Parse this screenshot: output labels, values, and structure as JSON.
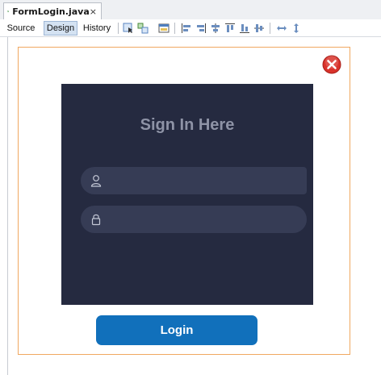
{
  "editor": {
    "file_tab": {
      "name": "FormLogin.java",
      "close": "×"
    },
    "views": [
      "Source",
      "Design",
      "History"
    ],
    "active_view": "Design"
  },
  "form": {
    "title": "Sign In Here",
    "username": {
      "value": "",
      "placeholder": ""
    },
    "password": {
      "value": "",
      "placeholder": ""
    },
    "login_label": "Login"
  },
  "colors": {
    "panel_bg": "#252a40",
    "field_bg": "#363c55",
    "title_color": "#8e93a6",
    "button_bg": "#1170bb",
    "close_red": "#d9332b",
    "frame_border": "#f0a860"
  },
  "icons": {
    "file": "java-form-icon",
    "close_window": "close-circle-icon",
    "user": "user-icon",
    "lock": "lock-icon"
  }
}
